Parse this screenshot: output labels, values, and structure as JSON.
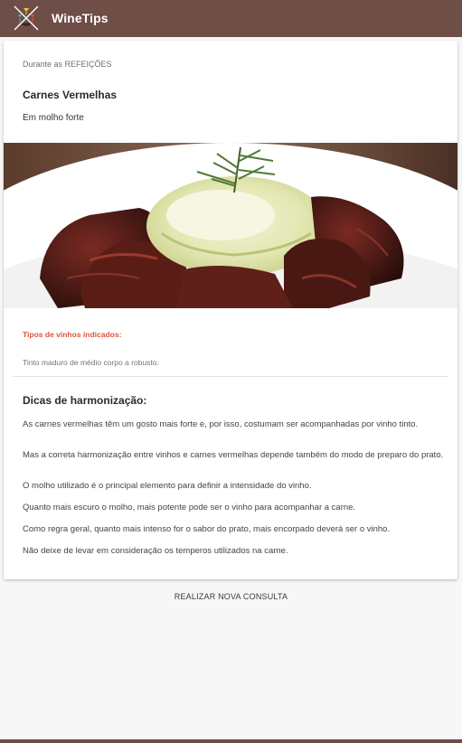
{
  "app": {
    "title": "WineTips",
    "logo": "wine-glasses-crossed-logo",
    "bar_color": "#6f4e47"
  },
  "card": {
    "eyebrow": "Durante as REFEIÇÕES",
    "title": "Carnes Vermelhas",
    "subtitle": "Em molho forte",
    "image_icon": "red-meat-with-risotto-photo",
    "wine_label": "Tipos de vinhos indicados:",
    "wine_value": "Tinto maduro de médio corpo a robusto.",
    "tips_heading": "Dicas de harmonização:",
    "tips": [
      "As carnes vermelhas têm um gosto mais forte e, por isso, costumam ser acompanhadas por vinho tinto.",
      "Mas a correta harmonização entre vinhos e carnes vermelhas depende também do modo de preparo do prato.",
      "O molho utilizado é o principal elemento para definir a intensidade do vinho.",
      "Quanto mais escuro o molho, mais potente pode ser o vinho para acompanhar a carne.",
      "Como regra geral, quanto mais intenso for o sabor do prato, mais encorpado deverá ser o vinho.",
      "Não deixe de levar em consideração os temperos utilizados na carne."
    ]
  },
  "action": {
    "label": "REALIZAR NOVA CONSULTA"
  },
  "colors": {
    "accent": "#e0533d",
    "background": "#f7f7f7"
  }
}
